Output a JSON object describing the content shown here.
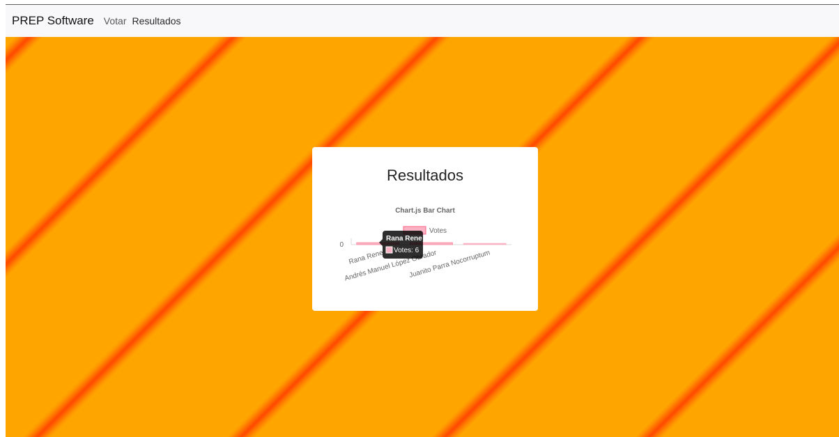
{
  "navbar": {
    "brand": "PREP Software",
    "links": [
      "Votar",
      "Resultados"
    ]
  },
  "card": {
    "title": "Resultados"
  },
  "chart_data": {
    "type": "bar",
    "title": "Chart.js Bar Chart",
    "categories": [
      "Rana Rene",
      "Andrés Manuel López Obrador",
      "Juanito Parra Nocorruptum"
    ],
    "series": [
      {
        "name": "Votes",
        "values": [
          6,
          6,
          0
        ]
      }
    ],
    "y_ticks": [
      "0"
    ],
    "legend": "top",
    "grid": false,
    "colors": {
      "bar_fill": "#f9b3c4",
      "bar_border": "#ff6384"
    }
  },
  "tooltip": {
    "title": "Rana Rene",
    "body": "Votes: 6"
  },
  "colors": {
    "background": "#ffa500",
    "stripe": "#ff4a00",
    "navbar": "#f8f8fa",
    "card": "#ffffff"
  }
}
